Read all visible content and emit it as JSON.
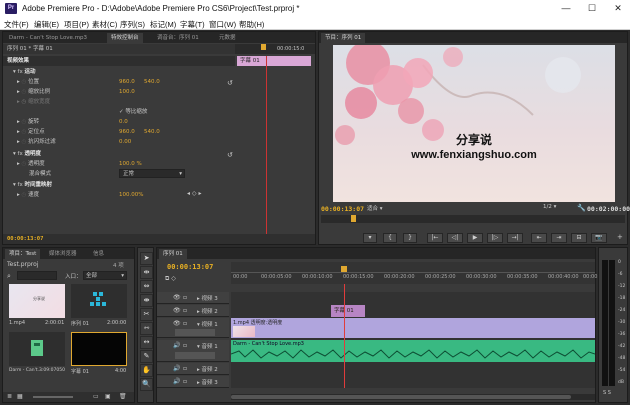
{
  "window": {
    "title": "Adobe Premiere Pro - D:\\Adobe\\Adobe Premiere Pro CS6\\Project\\Test.prproj *",
    "app_icon": "Pr",
    "controls": [
      "—",
      "☐",
      "✕"
    ]
  },
  "menu": [
    "文件(F)",
    "编辑(E)",
    "项目(P)",
    "素材(C)",
    "序列(S)",
    "标记(M)",
    "字幕(T)",
    "窗口(W)",
    "帮助(H)"
  ],
  "top_left_tabs": [
    "Darm - Can't Stop Love.mp3",
    "特效控制台",
    "调音台：序列 01",
    "元数据"
  ],
  "effect_controls": {
    "header": "序列 01 * 字幕 01",
    "video_effects": "视频效果",
    "motion": "运动",
    "position_label": "位置",
    "position_x": "960.0",
    "position_y": "540.0",
    "scale_label": "缩放比例",
    "scale_val": "100.0",
    "scale_w_label": "缩放宽度",
    "uniform_label": "等比缩放",
    "rotation_label": "旋转",
    "rotation_val": "0.0",
    "anchor_label": "定位点",
    "anchor_x": "960.0",
    "anchor_y": "540.0",
    "antiflicker_label": "抗闪烁过滤",
    "antiflicker_val": "0.00",
    "opacity_section": "透明度",
    "opacity_label": "透明度",
    "opacity_val": "100.0 %",
    "blend_label": "混合模式",
    "blend_val": "正常",
    "time_remap": "时间重映射",
    "speed_label": "速度",
    "speed_val": "100.00%",
    "timecode": "00:00:13:07",
    "mini_time": "00:00:15:0",
    "clip_label": "字幕 01"
  },
  "program": {
    "tab": "节目：序列 01",
    "overlay_title": "分享说",
    "overlay_url": "www.fenxiangshuo.com",
    "current_tc": "00:00:13:07",
    "fit": "适合",
    "ratio": "1/2",
    "duration_tc": "00:02:00:00",
    "controls": [
      "▾",
      "{",
      "}",
      "|←",
      "◁|",
      "▶",
      "|▷",
      "→|",
      "⇤",
      "⇥",
      "⊟",
      "📷"
    ]
  },
  "project": {
    "tabs": [
      "项目：Test",
      "媒体浏览器",
      "信息"
    ],
    "name": "Test.prproj",
    "count": "4 项",
    "search_label": "入口：",
    "search_val": "全部",
    "items": [
      {
        "name": "1.mp4",
        "dur": "2:00:01"
      },
      {
        "name": "序列 01",
        "dur": "2:00:00"
      },
      {
        "name": "Darm - Can't...",
        "dur": "3:09:07050"
      },
      {
        "name": "字幕 01",
        "dur": "4:00"
      }
    ]
  },
  "tools": [
    "➤",
    "⇹",
    "⇔",
    "⇼",
    "✂",
    "⇿",
    "↔",
    "✎",
    "✋",
    "🔍"
  ],
  "timeline": {
    "tab": "序列 01",
    "timecode": "00:00:13:07",
    "ruler": [
      "00:00",
      "00:00:05:00",
      "00:00:10:00",
      "00:00:15:00",
      "00:00:20:00",
      "00:00:25:00",
      "00:00:30:00",
      "00:00:35:00",
      "00:00:40:00",
      "00:00:45:00"
    ],
    "video_tracks": [
      "视频 3",
      "视频 2",
      "视频 1"
    ],
    "audio_tracks": [
      "音频 1",
      "音频 2",
      "音频 3"
    ],
    "source_label": "A1",
    "clips": {
      "title": "字幕 01",
      "video": "1.mp4  透明度:透明度",
      "audio": "Darm - Can't Stop Love.mp3"
    }
  },
  "audio_meter": {
    "scale": [
      "0",
      "-6",
      "-12",
      "-18",
      "-24",
      "-30",
      "-36",
      "-42",
      "-48",
      "-54",
      "dB"
    ]
  }
}
